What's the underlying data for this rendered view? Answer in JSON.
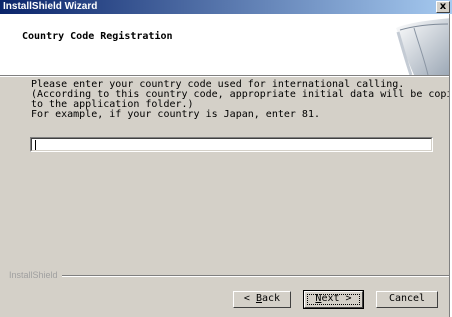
{
  "window": {
    "title": "InstallShield Wizard",
    "close_glyph": "x"
  },
  "header": {
    "title": "Country Code Registration"
  },
  "body": {
    "lines": [
      "Please enter your country code used for international calling.",
      "(According to this country code, appropriate initial data will be copied",
      "to the application folder.)",
      "For example, if your country is Japan, enter 81."
    ]
  },
  "input": {
    "country_code": ""
  },
  "footer": {
    "brand": "InstallShield",
    "back_label_prefix": "< ",
    "back_accel": "B",
    "back_label_rest": "ack",
    "next_accel": "N",
    "next_label_rest": "ext >",
    "cancel_label": "Cancel"
  },
  "colors": {
    "titlebar_start": "#0a246a",
    "titlebar_end": "#a6caf0",
    "dialog_face": "#d4d0c8"
  }
}
